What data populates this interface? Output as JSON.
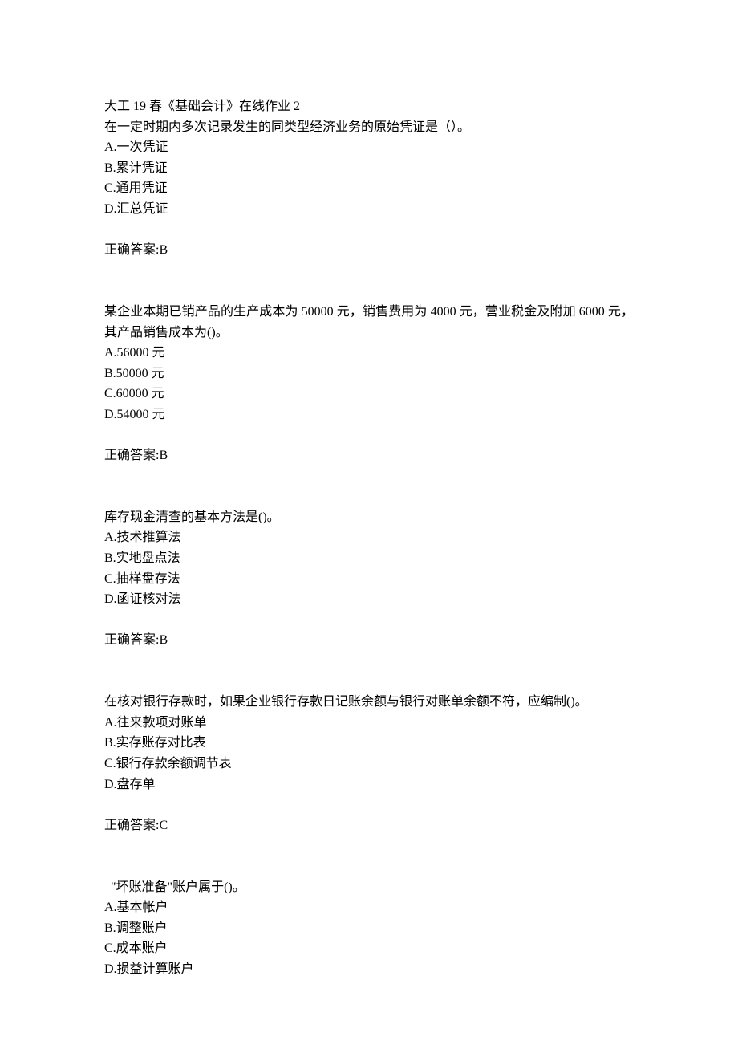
{
  "title": "大工 19 春《基础会计》在线作业 2",
  "questions": [
    {
      "prompt": "在一定时期内多次记录发生的同类型经济业务的原始凭证是（）。",
      "options": [
        "A.一次凭证",
        "B.累计凭证",
        "C.通用凭证",
        "D.汇总凭证"
      ],
      "answer": "正确答案:B"
    },
    {
      "prompt": "某企业本期已销产品的生产成本为 50000 元，销售费用为 4000 元，营业税金及附加 6000 元，其产品销售成本为()。",
      "options": [
        "A.56000 元",
        "B.50000 元",
        "C.60000 元",
        "D.54000 元"
      ],
      "answer": "正确答案:B"
    },
    {
      "prompt": "库存现金清查的基本方法是()。",
      "options": [
        "A.技术推算法",
        "B.实地盘点法",
        "C.抽样盘存法",
        "D.函证核对法"
      ],
      "answer": "正确答案:B"
    },
    {
      "prompt": "在核对银行存款时，如果企业银行存款日记账余额与银行对账单余额不符，应编制()。",
      "options": [
        "A.往来款项对账单",
        "B.实存账存对比表",
        "C.银行存款余额调节表",
        "D.盘存单"
      ],
      "answer": "正确答案:C"
    },
    {
      "prompt": "\"坏账准备\"账户属于()。",
      "options": [
        "A.基本帐户",
        "B.调整账户",
        "C.成本账户",
        "D.损益计算账户"
      ],
      "answer": ""
    }
  ]
}
